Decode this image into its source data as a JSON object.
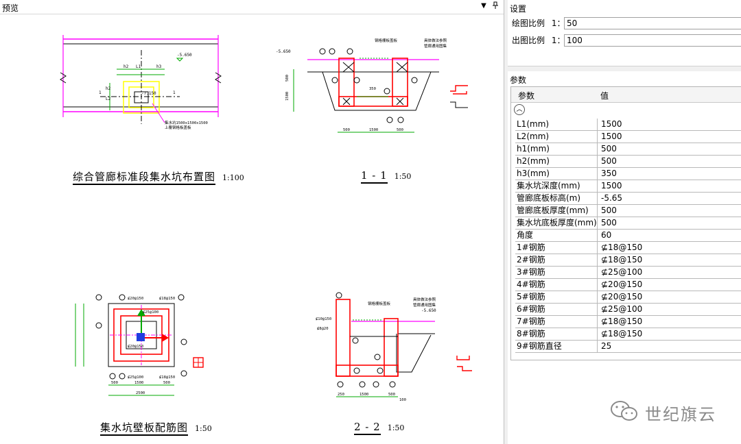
{
  "preview": {
    "title": "预览",
    "dropdown_icon": "chevron-down-icon",
    "pin_icon": "pin-icon"
  },
  "drawings": {
    "plan": {
      "title": "综合管廊标准段集水坑布置图",
      "scale": "1:100",
      "labels": {
        "elev": "-5.650",
        "l1": "L1",
        "h2": "h2",
        "h3": "h3",
        "h2b": "h2",
        "l2": "L2",
        "one_l": "1",
        "one_r": "1",
        "pit_elev": "-7.150",
        "note1": "集水坑1500x1500x1500",
        "note2": "上覆钢格板盖板"
      }
    },
    "section1": {
      "title": "1 - 1",
      "scale": "1:50",
      "labels": {
        "elev": "-5.650",
        "top_note1": "钢格栅板盖板",
        "top_note2": "具体做法参照",
        "top_note3": "管廊通用图集",
        "dim_bot": "1500",
        "dim_l": "500",
        "dim_r": "500",
        "dim_h": "350",
        "dim_v1": "500",
        "dim_v2": "1500"
      }
    },
    "wall": {
      "title": "集水坑壁板配筋图",
      "scale": "1:50",
      "labels": {
        "d1": "500",
        "d2": "1500",
        "d3": "500",
        "total": "2500",
        "r1": "⊈20@150",
        "r2": "⊈18@150",
        "r3": "⊈25@100",
        "r4": "⊈20@150",
        "r5": "⊈25@100",
        "r6": "⊈18@150"
      }
    },
    "section2": {
      "title": "2 - 2",
      "scale": "1:50",
      "labels": {
        "elev": "-5.650",
        "top_note1": "钢格栅板盖板",
        "top_note2": "具体做法参照",
        "top_note3": "管廊通用图集",
        "dim_bot": "1500",
        "dim_l": "250",
        "dim_r": "500",
        "dim_end": "100",
        "bar": "⊈10@150",
        "bar2": "⊈8@20"
      }
    }
  },
  "settings": {
    "title": "设置",
    "draw_scale": {
      "label": "绘图比例",
      "prefix": "1：",
      "value": "50"
    },
    "output_scale": {
      "label": "出图比例",
      "prefix": "1：",
      "value": "100"
    }
  },
  "params": {
    "title": "参数",
    "col_name": "参数",
    "col_value": "值",
    "rows": [
      {
        "k": "L1(mm)",
        "v": "1500"
      },
      {
        "k": "L2(mm)",
        "v": "1500"
      },
      {
        "k": "h1(mm)",
        "v": "500"
      },
      {
        "k": "h2(mm)",
        "v": "500"
      },
      {
        "k": "h3(mm)",
        "v": "350"
      },
      {
        "k": "集水坑深度(mm)",
        "v": "1500"
      },
      {
        "k": "管廊底板标高(m)",
        "v": "-5.65"
      },
      {
        "k": "管廊底板厚度(mm)",
        "v": "500"
      },
      {
        "k": "集水坑底板厚度(mm)",
        "v": "500"
      },
      {
        "k": "角度",
        "v": "60"
      },
      {
        "k": "1#钢筋",
        "v": "⊈18@150"
      },
      {
        "k": "2#钢筋",
        "v": "⊈18@150"
      },
      {
        "k": "3#钢筋",
        "v": "⊈25@100"
      },
      {
        "k": "4#钢筋",
        "v": "⊈20@150"
      },
      {
        "k": "5#钢筋",
        "v": "⊈20@150"
      },
      {
        "k": "6#钢筋",
        "v": "⊈25@100"
      },
      {
        "k": "7#钢筋",
        "v": "⊈18@150"
      },
      {
        "k": "8#钢筋",
        "v": "⊈18@150"
      },
      {
        "k": "9#钢筋直径",
        "v": "25"
      }
    ]
  },
  "watermark": {
    "text": "世纪旗云",
    "icon": "wechat-icon"
  }
}
